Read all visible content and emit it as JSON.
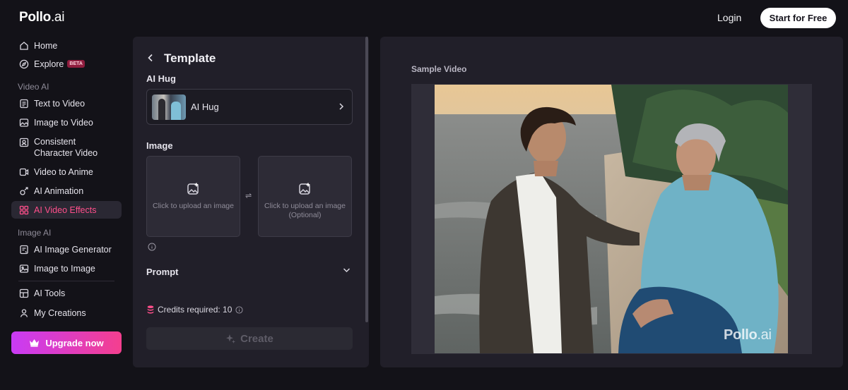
{
  "header": {
    "logo_main": "Pollo",
    "logo_suffix": ".ai",
    "login_label": "Login",
    "start_label": "Start for Free"
  },
  "sidebar": {
    "items_top": [
      {
        "label": "Home",
        "icon": "home-icon"
      },
      {
        "label": "Explore",
        "icon": "compass-icon",
        "badge": "BETA"
      }
    ],
    "video_section": "Video AI",
    "video_items": [
      {
        "label": "Text to Video",
        "icon": "text-video-icon"
      },
      {
        "label": "Image to Video",
        "icon": "image-video-icon"
      },
      {
        "label": "Consistent Character Video",
        "icon": "character-icon"
      },
      {
        "label": "Video to Anime",
        "icon": "anime-icon"
      },
      {
        "label": "AI Animation",
        "icon": "animation-icon"
      },
      {
        "label": "AI Video Effects",
        "icon": "effects-icon",
        "active": true
      }
    ],
    "image_section": "Image AI",
    "image_items": [
      {
        "label": "AI Image Generator",
        "icon": "image-generator-icon"
      },
      {
        "label": "Image to Image",
        "icon": "image-to-image-icon"
      }
    ],
    "bottom_items": [
      {
        "label": "AI Tools",
        "icon": "tools-icon"
      },
      {
        "label": "My Creations",
        "icon": "creations-icon"
      }
    ],
    "upgrade_label": "Upgrade now",
    "accent_color": "#ff4f8b"
  },
  "template_panel": {
    "title": "Template",
    "template_section": "AI Hug",
    "selected_template": "AI Hug",
    "image_section": "Image",
    "upload_1": "Click to upload an image",
    "upload_2_line1": "Click to upload an image",
    "upload_2_line2": "(Optional)",
    "swap_glyph": "⇌",
    "prompt_section": "Prompt",
    "credits_text": "Credits required: 10",
    "create_label": "Create"
  },
  "preview_panel": {
    "label": "Sample Video",
    "watermark_main": "Pollo",
    "watermark_suffix": ".ai"
  }
}
